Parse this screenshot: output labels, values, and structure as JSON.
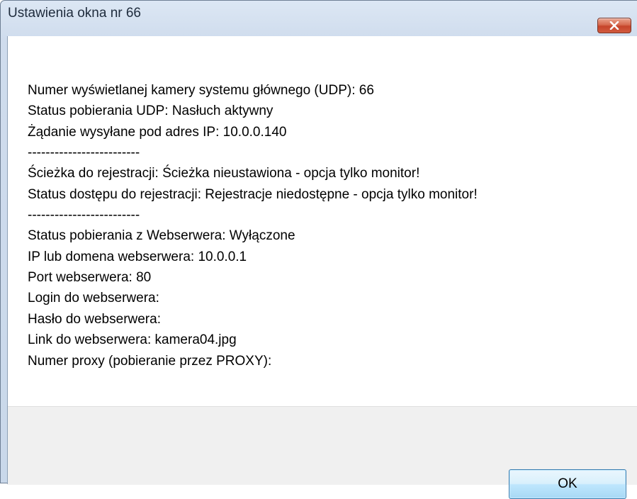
{
  "window": {
    "title": "Ustawienia okna nr 66",
    "close_icon": "close-x-icon"
  },
  "message": {
    "lines": [
      "Numer wyświetlanej kamery systemu głównego (UDP): 66",
      "Status pobierania UDP: Nasłuch aktywny",
      "Żądanie wysyłane pod adres IP: 10.0.0.140",
      "-------------------------",
      "Ścieżka do rejestracji: Ścieżka nieustawiona - opcja tylko monitor!",
      "Status dostępu do rejestracji: Rejestracje niedostępne - opcja tylko monitor!",
      "-------------------------",
      "Status pobierania z Webserwera: Wyłączone",
      "IP lub domena webserwera: 10.0.0.1",
      "Port webserwera: 80",
      "Login do webserwera:",
      "Hasło do webserwera:",
      "Link do webserwera: kamera04.jpg",
      "Numer proxy (pobieranie przez PROXY):"
    ]
  },
  "buttons": {
    "ok_label": "OK"
  },
  "colors": {
    "close_button": "#c6442b",
    "ok_button_border": "#3c7fb1",
    "footer_background": "#f0f0f0"
  }
}
